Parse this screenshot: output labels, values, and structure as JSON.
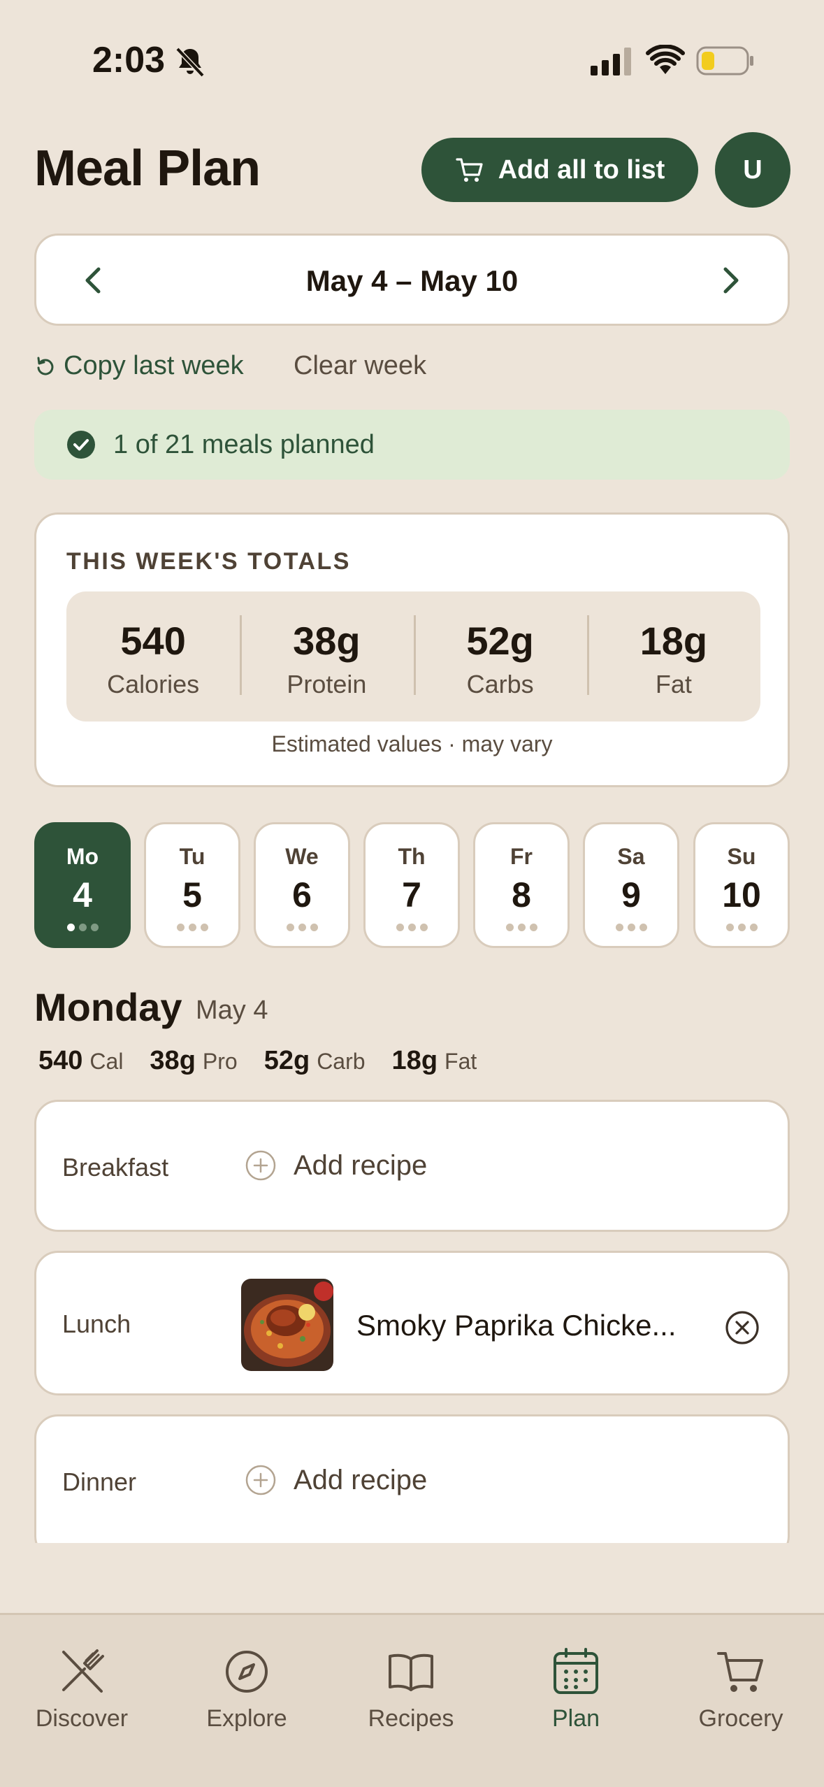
{
  "status_bar": {
    "time": "2:03"
  },
  "header": {
    "title": "Meal Plan",
    "add_all_label": "Add all to list",
    "avatar_initial": "U"
  },
  "week": {
    "range_label": "May 4 – May 10",
    "copy_last_week": "Copy last week",
    "clear_week": "Clear week"
  },
  "progress": {
    "text": "1 of 21 meals planned"
  },
  "totals": {
    "heading": "THIS WEEK'S TOTALS",
    "items": [
      {
        "value": "540",
        "label": "Calories"
      },
      {
        "value": "38g",
        "label": "Protein"
      },
      {
        "value": "52g",
        "label": "Carbs"
      },
      {
        "value": "18g",
        "label": "Fat"
      }
    ],
    "note": "Estimated values · may vary"
  },
  "days": [
    {
      "abbr": "Mo",
      "num": "4",
      "active": true,
      "meals_planned": 1
    },
    {
      "abbr": "Tu",
      "num": "5",
      "active": false,
      "meals_planned": 0
    },
    {
      "abbr": "We",
      "num": "6",
      "active": false,
      "meals_planned": 0
    },
    {
      "abbr": "Th",
      "num": "7",
      "active": false,
      "meals_planned": 0
    },
    {
      "abbr": "Fr",
      "num": "8",
      "active": false,
      "meals_planned": 0
    },
    {
      "abbr": "Sa",
      "num": "9",
      "active": false,
      "meals_planned": 0
    },
    {
      "abbr": "Su",
      "num": "10",
      "active": false,
      "meals_planned": 0
    }
  ],
  "selected_day": {
    "name": "Monday",
    "date": "May 4",
    "macros": [
      {
        "value": "540",
        "unit": "Cal"
      },
      {
        "value": "38g",
        "unit": "Pro"
      },
      {
        "value": "52g",
        "unit": "Carb"
      },
      {
        "value": "18g",
        "unit": "Fat"
      }
    ]
  },
  "meals": {
    "breakfast": {
      "label": "Breakfast",
      "add_label": "Add recipe"
    },
    "lunch": {
      "label": "Lunch",
      "recipe_name": "Smoky Paprika Chicke..."
    },
    "dinner": {
      "label": "Dinner",
      "add_label": "Add recipe"
    }
  },
  "tabs": [
    {
      "label": "Discover",
      "icon": "utensils-icon"
    },
    {
      "label": "Explore",
      "icon": "compass-icon"
    },
    {
      "label": "Recipes",
      "icon": "book-icon"
    },
    {
      "label": "Plan",
      "icon": "calendar-icon",
      "active": true
    },
    {
      "label": "Grocery",
      "icon": "cart-icon"
    }
  ],
  "colors": {
    "background": "#ede4d9",
    "primary": "#2e5339",
    "success_bg": "#dfebd5",
    "card": "#ffffff",
    "border": "#d9ccbc"
  }
}
